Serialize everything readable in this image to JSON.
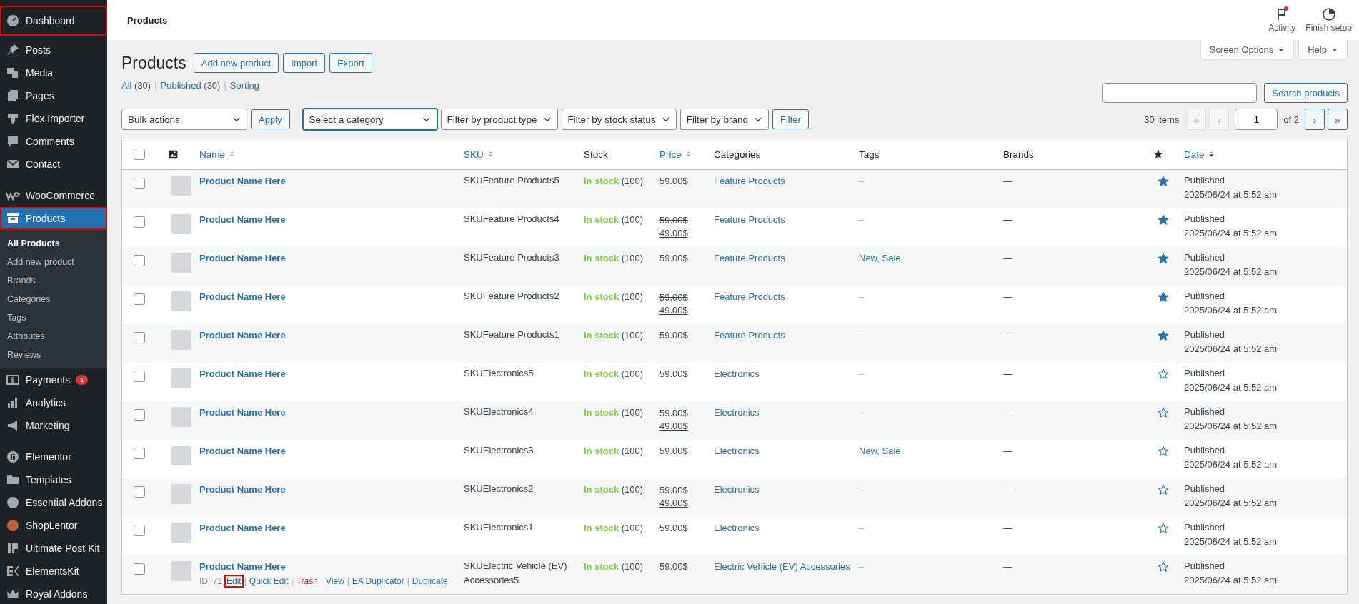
{
  "admin_menu": {
    "groups": [
      [
        {
          "label": "Dashboard",
          "selected": false,
          "highlighted": true
        },
        {
          "label": "Posts",
          "selected": false,
          "highlighted": false
        },
        {
          "label": "Media",
          "selected": false,
          "highlighted": false
        },
        {
          "label": "Pages",
          "selected": false,
          "highlighted": false
        },
        {
          "label": "Flex Importer",
          "selected": false,
          "highlighted": false
        },
        {
          "label": "Comments",
          "selected": false,
          "highlighted": false
        },
        {
          "label": "Contact",
          "selected": false,
          "highlighted": false
        }
      ],
      [
        {
          "label": "WooCommerce",
          "selected": false,
          "highlighted": false
        },
        {
          "label": "Products",
          "selected": true,
          "highlighted": true,
          "submenu": [
            {
              "label": "All Products",
              "selected": true
            },
            {
              "label": "Add new product",
              "selected": false
            },
            {
              "label": "Brands",
              "selected": false
            },
            {
              "label": "Categories",
              "selected": false
            },
            {
              "label": "Tags",
              "selected": false
            },
            {
              "label": "Attributes",
              "selected": false
            },
            {
              "label": "Reviews",
              "selected": false
            }
          ]
        },
        {
          "label": "Payments",
          "selected": false,
          "highlighted": false,
          "badge": "1"
        },
        {
          "label": "Analytics",
          "selected": false,
          "highlighted": false
        },
        {
          "label": "Marketing",
          "selected": false,
          "highlighted": false
        }
      ],
      [
        {
          "label": "Elementor",
          "selected": false,
          "highlighted": false
        },
        {
          "label": "Templates",
          "selected": false,
          "highlighted": false
        },
        {
          "label": "Essential Addons",
          "selected": false,
          "highlighted": false
        },
        {
          "label": "ShopLentor",
          "selected": false,
          "highlighted": false
        },
        {
          "label": "Ultimate Post Kit",
          "selected": false,
          "highlighted": false
        },
        {
          "label": "ElementsKit",
          "selected": false,
          "highlighted": false
        },
        {
          "label": "Royal Addons",
          "selected": false,
          "highlighted": false
        }
      ]
    ]
  },
  "top_bar": {
    "title": "Products",
    "actions": [
      {
        "label": "Activity",
        "notification": true
      },
      {
        "label": "Finish setup",
        "notification": false
      }
    ]
  },
  "screen_meta": [
    "Screen Options",
    "Help"
  ],
  "heading": {
    "title": "Products",
    "buttons": [
      "Add new product",
      "Import",
      "Export"
    ]
  },
  "views": {
    "separator": "|",
    "items": [
      {
        "label": "All",
        "count": "(30)"
      },
      {
        "label": "Published",
        "count": "(30)"
      },
      {
        "label": "Sorting"
      }
    ]
  },
  "search": {
    "button": "Search products"
  },
  "filters": {
    "bulk_action": "Bulk actions",
    "apply": "Apply",
    "dropdowns": [
      {
        "label": "Select a category",
        "focused": true
      },
      {
        "label": "Filter by product type",
        "focused": false
      },
      {
        "label": "Filter by stock status",
        "focused": false
      },
      {
        "label": "Filter by brand",
        "focused": false
      }
    ],
    "filter_button": "Filter"
  },
  "pagination": {
    "count": "30 items",
    "buttons": [
      {
        "label": "«",
        "disabled": true
      },
      {
        "label": "‹",
        "disabled": true
      }
    ],
    "page": "1",
    "of": "of 2",
    "next_buttons": [
      {
        "label": "›",
        "disabled": false
      },
      {
        "label": "»",
        "disabled": false
      }
    ]
  },
  "table": {
    "columns": [
      {
        "kind": "checkbox",
        "checked": false
      },
      {
        "kind": "image"
      },
      {
        "kind": "text",
        "label": "Name",
        "sortable": true,
        "sorted": false
      },
      {
        "kind": "text",
        "label": "SKU",
        "sortable": true,
        "sorted": false
      },
      {
        "kind": "text",
        "label": "Stock",
        "sortable": false
      },
      {
        "kind": "text",
        "label": "Price",
        "sortable": true,
        "sorted": false
      },
      {
        "kind": "text",
        "label": "Categories",
        "sortable": false
      },
      {
        "kind": "text",
        "label": "Tags",
        "sortable": false
      },
      {
        "kind": "text",
        "label": "Brands",
        "sortable": false
      },
      {
        "kind": "featured"
      },
      {
        "kind": "text",
        "label": "Date",
        "sortable": true,
        "sorted": true
      }
    ],
    "rows": [
      {
        "checked": false,
        "name": "Product Name Here",
        "sku": "SKUFeature Products5",
        "stock": "In stock",
        "stock_count": "(100)",
        "price": "59.00$",
        "category": "Feature Products",
        "tags": "–",
        "brands": "—",
        "featured": true,
        "status": "Published",
        "date": "2025/06/24 at 5:52 am"
      },
      {
        "checked": false,
        "name": "Product Name Here",
        "sku": "SKUFeature Products4",
        "stock": "In stock",
        "stock_count": "(100)",
        "price": "59.00$",
        "sale_price": "49.00$",
        "category": "Feature Products",
        "tags": "–",
        "brands": "—",
        "featured": true,
        "status": "Published",
        "date": "2025/06/24 at 5:52 am"
      },
      {
        "checked": false,
        "name": "Product Name Here",
        "sku": "SKUFeature Products3",
        "stock": "In stock",
        "stock_count": "(100)",
        "price": "59.00$",
        "category": "Feature Products",
        "tags": "New, Sale",
        "brands": "—",
        "featured": true,
        "status": "Published",
        "date": "2025/06/24 at 5:52 am"
      },
      {
        "checked": false,
        "name": "Product Name Here",
        "sku": "SKUFeature Products2",
        "stock": "In stock",
        "stock_count": "(100)",
        "price": "59.00$",
        "sale_price": "49.00$",
        "category": "Feature Products",
        "tags": "–",
        "brands": "—",
        "featured": true,
        "status": "Published",
        "date": "2025/06/24 at 5:52 am"
      },
      {
        "checked": false,
        "name": "Product Name Here",
        "sku": "SKUFeature Products1",
        "stock": "In stock",
        "stock_count": "(100)",
        "price": "59.00$",
        "category": "Feature Products",
        "tags": "–",
        "brands": "—",
        "featured": true,
        "status": "Published",
        "date": "2025/06/24 at 5:52 am"
      },
      {
        "checked": false,
        "name": "Product Name Here",
        "sku": "SKUElectronics5",
        "stock": "In stock",
        "stock_count": "(100)",
        "price": "59.00$",
        "category": "Electronics",
        "tags": "–",
        "brands": "—",
        "featured": false,
        "status": "Published",
        "date": "2025/06/24 at 5:52 am"
      },
      {
        "checked": false,
        "name": "Product Name Here",
        "sku": "SKUElectronics4",
        "stock": "In stock",
        "stock_count": "(100)",
        "price": "59.00$",
        "sale_price": "49.00$",
        "category": "Electronics",
        "tags": "–",
        "brands": "—",
        "featured": false,
        "status": "Published",
        "date": "2025/06/24 at 5:52 am"
      },
      {
        "checked": false,
        "name": "Product Name Here",
        "sku": "SKUElectronics3",
        "stock": "In stock",
        "stock_count": "(100)",
        "price": "59.00$",
        "category": "Electronics",
        "tags": "New, Sale",
        "brands": "—",
        "featured": false,
        "status": "Published",
        "date": "2025/06/24 at 5:52 am"
      },
      {
        "checked": false,
        "name": "Product Name Here",
        "sku": "SKUElectronics2",
        "stock": "In stock",
        "stock_count": "(100)",
        "price": "59.00$",
        "sale_price": "49.00$",
        "category": "Electronics",
        "tags": "–",
        "brands": "—",
        "featured": false,
        "status": "Published",
        "date": "2025/06/24 at 5:52 am"
      },
      {
        "checked": false,
        "name": "Product Name Here",
        "sku": "SKUElectronics1",
        "stock": "In stock",
        "stock_count": "(100)",
        "price": "59.00$",
        "category": "Electronics",
        "tags": "–",
        "brands": "—",
        "featured": false,
        "status": "Published",
        "date": "2025/06/24 at 5:52 am"
      },
      {
        "checked": false,
        "name": "Product Name Here",
        "id": "ID: 72",
        "actions": [
          {
            "label": "Edit",
            "kind": "link",
            "highlighted": true
          },
          {
            "label": "Quick Edit",
            "kind": "link",
            "highlighted": false
          },
          {
            "label": "Trash",
            "kind": "danger",
            "highlighted": false
          },
          {
            "label": "View",
            "kind": "link",
            "highlighted": false
          },
          {
            "label": "EA Duplicator",
            "kind": "link",
            "highlighted": false
          },
          {
            "label": "Duplicate",
            "kind": "link",
            "highlighted": false
          }
        ],
        "action_separator": "|",
        "sku": "SKUElectric Vehicle (EV) Accessories5",
        "stock": "In stock",
        "stock_count": "(100)",
        "price": "59.00$",
        "category": "Electric Vehicle (EV) Accessories",
        "tags": "–",
        "brands": "—",
        "featured": false,
        "status": "Published",
        "date": "2025/06/24 at 5:52 am"
      }
    ]
  }
}
